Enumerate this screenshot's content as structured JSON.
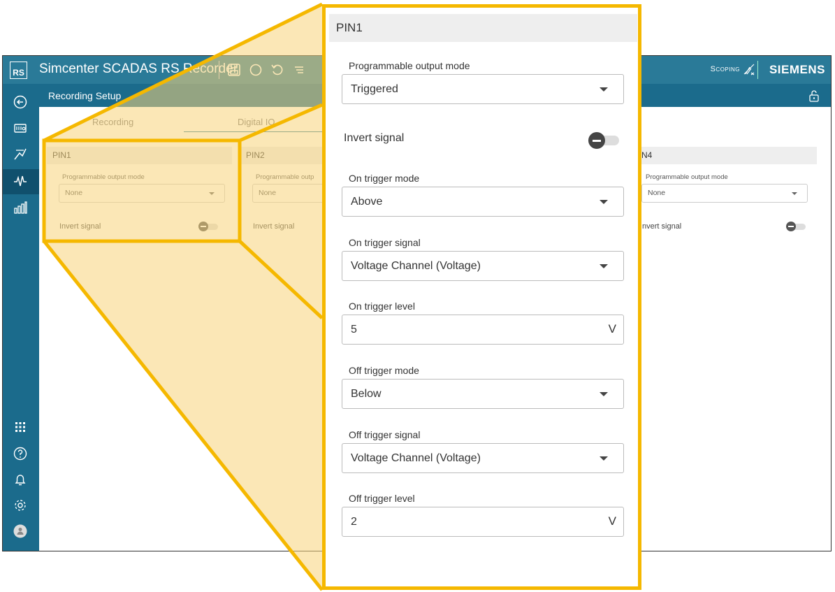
{
  "app": {
    "logo": "RS",
    "title": "Simcenter SCADAS RS Recorder",
    "mode_label": "Scoping",
    "brand": "SIEMENS"
  },
  "header": {
    "title": "Recording Setup"
  },
  "tabs": [
    {
      "label": "Recording"
    },
    {
      "label": "Digital IO",
      "active": true
    }
  ],
  "pins": [
    {
      "name": "PIN1",
      "mode_label": "Programmable output mode",
      "mode_value": "None",
      "invert_label": "Invert signal"
    },
    {
      "name": "PIN2",
      "mode_label": "Programmable outp",
      "mode_value": "None",
      "invert_label": "Invert signal"
    },
    {
      "name": "N4",
      "mode_label": "Programmable output mode",
      "mode_value": "None",
      "invert_label": "nvert signal"
    }
  ],
  "detail": {
    "title": "PIN1",
    "output_mode_label": "Programmable output mode",
    "output_mode_value": "Triggered",
    "invert_label": "Invert signal",
    "on_trigger_mode_label": "On trigger mode",
    "on_trigger_mode_value": "Above",
    "on_trigger_signal_label": "On trigger signal",
    "on_trigger_signal_value": "Voltage Channel (Voltage)",
    "on_trigger_level_label": "On trigger level",
    "on_trigger_level_value": "5",
    "on_trigger_level_unit": "V",
    "off_trigger_mode_label": "Off trigger mode",
    "off_trigger_mode_value": "Below",
    "off_trigger_signal_label": "Off trigger signal",
    "off_trigger_signal_value": "Voltage Channel (Voltage)",
    "off_trigger_level_label": "Off trigger level",
    "off_trigger_level_value": "2",
    "off_trigger_level_unit": "V"
  },
  "colors": {
    "titlebar": "#2a7a98",
    "sidebar": "#1b6b8c",
    "highlight": "#f5b800",
    "overlay": "#f7d37a"
  }
}
